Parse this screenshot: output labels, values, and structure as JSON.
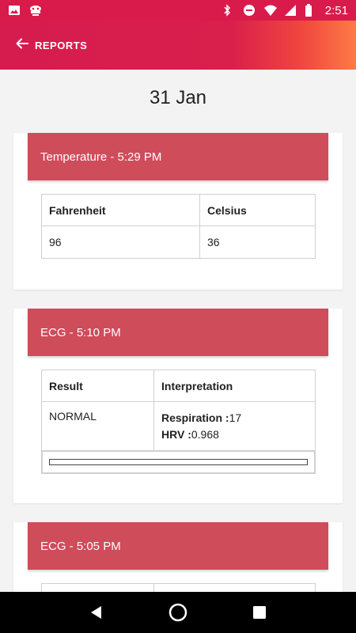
{
  "status_bar": {
    "time": "2:51",
    "left_icons": [
      "image-icon",
      "notification-icon"
    ],
    "right_icons": [
      "bluetooth-icon",
      "do-not-disturb-icon",
      "wifi-icon",
      "signal-icon",
      "battery-icon"
    ]
  },
  "app_bar": {
    "back_label": "REPORTS"
  },
  "page": {
    "date": "31 Jan"
  },
  "reports": [
    {
      "title": "Temperature - 5:29 PM",
      "headers": [
        "Fahrenheit",
        "Celsius"
      ],
      "values": [
        "96",
        "36"
      ]
    },
    {
      "title": "ECG - 5:10 PM",
      "headers": [
        "Result",
        "Interpretation"
      ],
      "result": "NORMAL",
      "respiration_label": "Respiration :",
      "respiration_value": "17",
      "hrv_label": "HRV :",
      "hrv_value": "0.968"
    },
    {
      "title": "ECG - 5:05 PM"
    }
  ],
  "colors": {
    "status_bar": "#d81b4a",
    "header_gradient_start": "#d61c4e",
    "header_gradient_end": "#fd7b46",
    "card_header": "#cf4c5b",
    "background": "#f3f3f3"
  }
}
